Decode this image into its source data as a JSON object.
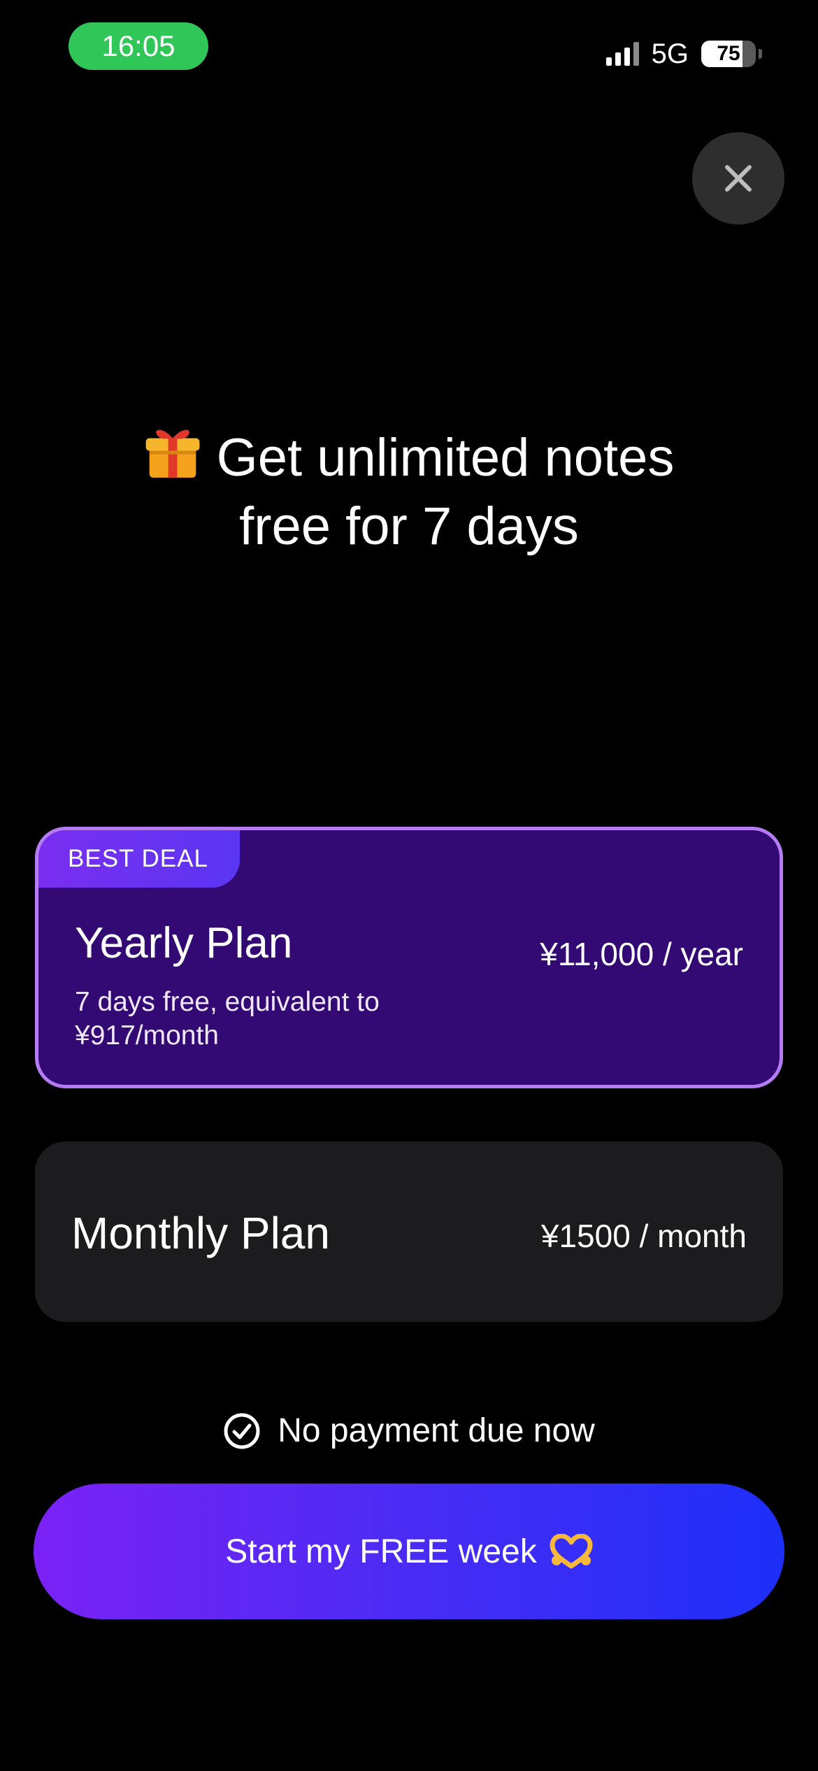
{
  "status_bar": {
    "time": "16:05",
    "network": "5G",
    "battery": "75",
    "battery_level_percent": 75
  },
  "close_icon": "close-icon",
  "headline": {
    "icon": "gift-icon",
    "line1": "Get unlimited notes",
    "line2": "free for 7 days"
  },
  "plans": {
    "yearly": {
      "badge": "BEST DEAL",
      "title": "Yearly Plan",
      "subtitle": "7 days free, equivalent to ¥917/month",
      "price": "¥11,000 / year",
      "selected": true
    },
    "monthly": {
      "title": "Monthly Plan",
      "price": "¥1500 / month",
      "selected": false
    }
  },
  "notice": {
    "icon": "check-circle-icon",
    "text": "No payment due now"
  },
  "cta": {
    "label": "Start my FREE week",
    "icon": "heart-hands-icon"
  },
  "colors": {
    "background": "#000000",
    "time_pill": "#30c758",
    "yearly_card": "#330a73",
    "yearly_border": "#b57cf5",
    "monthly_card": "#1c1c1e",
    "cta_start": "#7b22f5",
    "cta_end": "#1d2ff8"
  }
}
